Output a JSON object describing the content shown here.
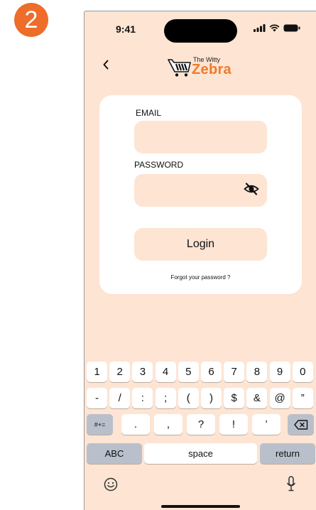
{
  "step": {
    "number": "2"
  },
  "status": {
    "time": "9:41"
  },
  "brand": {
    "small": "The Witty",
    "name": "Zebra"
  },
  "form": {
    "email_label": "EMAIL",
    "email_value": "",
    "password_label": "PASSWORD",
    "password_value": "",
    "login_label": "Login",
    "forgot_label": "Forgot your password ?"
  },
  "keyboard": {
    "row1": [
      "1",
      "2",
      "3",
      "4",
      "5",
      "6",
      "7",
      "8",
      "9",
      "0"
    ],
    "row2": [
      "-",
      "/",
      ":",
      ";",
      "(",
      ")",
      "$",
      "&",
      "@",
      "”"
    ],
    "row3_toggle": "#+=",
    "row3": [
      ".",
      ",",
      "?",
      "!",
      "’"
    ],
    "abc_label": "ABC",
    "space_label": "space",
    "return_label": "return"
  },
  "icons": {
    "back": "chevron-left-icon",
    "eye": "eye-slash-icon",
    "backspace": "backspace-icon",
    "emoji": "emoji-icon",
    "mic": "microphone-icon"
  },
  "colors": {
    "background": "#fde4d3",
    "accent": "#f07a2b",
    "badge": "#ee6d2a",
    "card": "#ffffff"
  }
}
